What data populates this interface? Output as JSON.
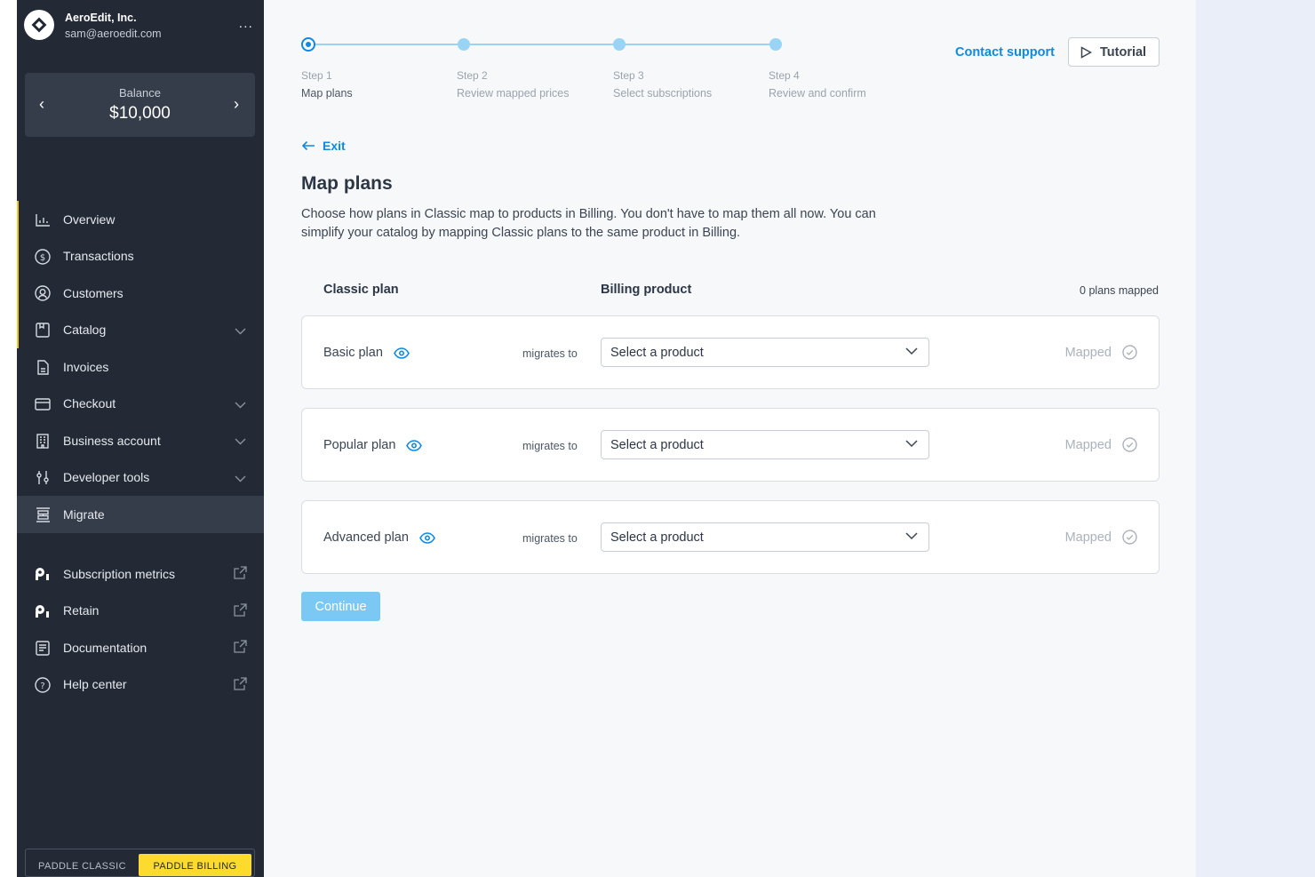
{
  "account": {
    "name": "AeroEdit, Inc.",
    "email": "sam@aeroedit.com",
    "more": "..."
  },
  "balance": {
    "label": "Balance",
    "value": "$10,000",
    "prev": "‹",
    "next": "›"
  },
  "nav": [
    {
      "label": "Overview",
      "icon": "chart-icon"
    },
    {
      "label": "Transactions",
      "icon": "dollar-circle-icon"
    },
    {
      "label": "Customers",
      "icon": "user-circle-icon"
    },
    {
      "label": "Catalog",
      "icon": "catalog-icon",
      "expandable": true
    },
    {
      "label": "Invoices",
      "icon": "document-icon"
    },
    {
      "label": "Checkout",
      "icon": "card-icon",
      "expandable": true
    },
    {
      "label": "Business account",
      "icon": "building-icon",
      "expandable": true
    },
    {
      "label": "Developer tools",
      "icon": "sliders-icon",
      "expandable": true
    },
    {
      "label": "Migrate",
      "icon": "migrate-icon",
      "active": true
    }
  ],
  "nav_external": [
    {
      "label": "Subscription metrics",
      "icon": "paddle-icon"
    },
    {
      "label": "Retain",
      "icon": "paddle-icon"
    },
    {
      "label": "Documentation",
      "icon": "docs-icon"
    },
    {
      "label": "Help center",
      "icon": "help-circle-icon"
    }
  ],
  "toggle": {
    "classic": "PADDLE CLASSIC",
    "billing": "PADDLE BILLING",
    "active": "billing"
  },
  "steps": [
    {
      "num": "Step 1",
      "name": "Map plans",
      "current": true
    },
    {
      "num": "Step 2",
      "name": "Review mapped prices"
    },
    {
      "num": "Step 3",
      "name": "Select subscriptions"
    },
    {
      "num": "Step 4",
      "name": "Review and confirm"
    }
  ],
  "header": {
    "contact": "Contact support",
    "tutorial": "Tutorial"
  },
  "exit": "Exit",
  "title": "Map plans",
  "description": "Choose how plans in Classic map to products in Billing. You don't have to map them all now. You can simplify your catalog by mapping Classic plans to the same product in Billing.",
  "table": {
    "col_classic": "Classic plan",
    "col_billing": "Billing product",
    "count": "0 plans mapped",
    "migrates_to": "migrates to",
    "select_placeholder": "Select a product",
    "mapped_label": "Mapped",
    "rows": [
      {
        "plan": "Basic plan"
      },
      {
        "plan": "Popular plan"
      },
      {
        "plan": "Advanced plan"
      }
    ]
  },
  "continue": "Continue",
  "colors": {
    "accent": "#0f8ae0",
    "sidebar": "#232a36",
    "highlight": "#fddb2e"
  }
}
